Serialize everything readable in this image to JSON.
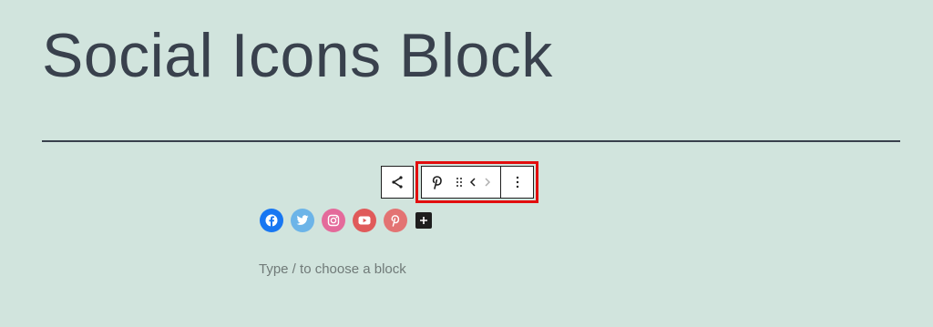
{
  "page": {
    "title": "Social Icons Block"
  },
  "block_toolbar": {
    "share_icon": "share-icon",
    "block_icon": "pinterest-icon",
    "drag_icon": "drag-handle-icon",
    "move_left_icon": "chevron-left-icon",
    "move_right_icon": "chevron-right-icon",
    "options_icon": "more-vertical-icon",
    "highlight_color": "#e20e0e"
  },
  "social_icons": [
    {
      "name": "Facebook",
      "color": "#1877f2",
      "icon": "facebook-icon"
    },
    {
      "name": "Twitter",
      "color": "#6cb4e8",
      "icon": "twitter-icon"
    },
    {
      "name": "Instagram",
      "color": "#e46a9b",
      "icon": "instagram-icon"
    },
    {
      "name": "YouTube",
      "color": "#e05a5a",
      "icon": "youtube-icon"
    },
    {
      "name": "Pinterest",
      "color": "#e37373",
      "icon": "pinterest-icon"
    }
  ],
  "add_button": {
    "icon": "plus-icon"
  },
  "editor": {
    "placeholder": "Type / to choose a block"
  },
  "colors": {
    "background": "#d1e4dd",
    "text": "#39414d"
  }
}
